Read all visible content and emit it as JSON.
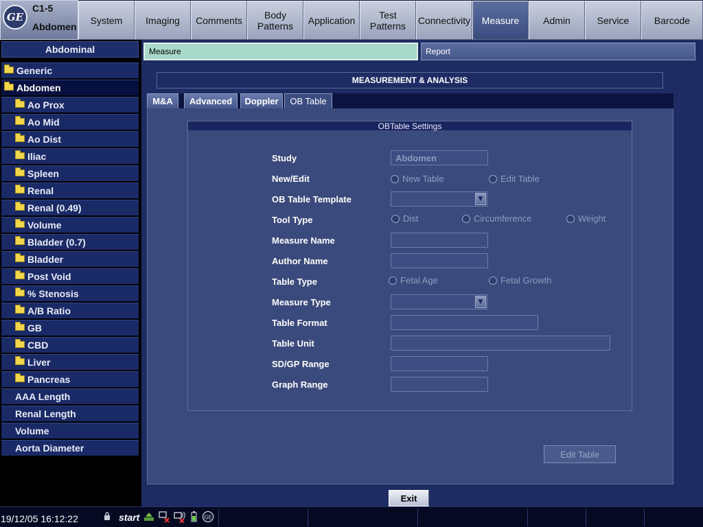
{
  "header": {
    "logo_text": "GE",
    "probe": "C1-5",
    "preset": "Abdomen",
    "tabs": [
      {
        "label": "System",
        "active": false
      },
      {
        "label": "Imaging",
        "active": false
      },
      {
        "label": "Comments",
        "active": false
      },
      {
        "label": "Body\nPatterns",
        "active": false
      },
      {
        "label": "Application",
        "active": false
      },
      {
        "label": "Test\nPatterns",
        "active": false
      },
      {
        "label": "Connectivity",
        "active": false
      },
      {
        "label": "Measure",
        "active": true
      },
      {
        "label": "Admin",
        "active": false
      },
      {
        "label": "Service",
        "active": false
      },
      {
        "label": "Barcode",
        "active": false
      }
    ]
  },
  "sidebar": {
    "header": "Abdominal",
    "items": [
      {
        "label": "Generic",
        "folder": true,
        "level": 0,
        "active": false
      },
      {
        "label": "Abdomen",
        "folder": true,
        "level": 0,
        "active": true
      },
      {
        "label": "Ao Prox",
        "folder": true,
        "level": 1,
        "active": false
      },
      {
        "label": "Ao Mid",
        "folder": true,
        "level": 1,
        "active": false
      },
      {
        "label": "Ao Dist",
        "folder": true,
        "level": 1,
        "active": false
      },
      {
        "label": "Iliac",
        "folder": true,
        "level": 1,
        "active": false
      },
      {
        "label": "Spleen",
        "folder": true,
        "level": 1,
        "active": false
      },
      {
        "label": "Renal",
        "folder": true,
        "level": 1,
        "active": false
      },
      {
        "label": "Renal (0.49)",
        "folder": true,
        "level": 1,
        "active": false
      },
      {
        "label": "Volume",
        "folder": true,
        "level": 1,
        "active": false
      },
      {
        "label": "Bladder (0.7)",
        "folder": true,
        "level": 1,
        "active": false
      },
      {
        "label": "Bladder",
        "folder": true,
        "level": 1,
        "active": false
      },
      {
        "label": "Post Void",
        "folder": true,
        "level": 1,
        "active": false
      },
      {
        "label": "% Stenosis",
        "folder": true,
        "level": 1,
        "active": false
      },
      {
        "label": "A/B Ratio",
        "folder": true,
        "level": 1,
        "active": false
      },
      {
        "label": "GB",
        "folder": true,
        "level": 1,
        "active": false
      },
      {
        "label": "CBD",
        "folder": true,
        "level": 1,
        "active": false
      },
      {
        "label": "Liver",
        "folder": true,
        "level": 1,
        "active": false
      },
      {
        "label": "Pancreas",
        "folder": true,
        "level": 1,
        "active": false
      },
      {
        "label": "AAA Length",
        "folder": false,
        "level": 1,
        "active": false
      },
      {
        "label": "Renal Length",
        "folder": false,
        "level": 1,
        "active": false
      },
      {
        "label": "Volume",
        "folder": false,
        "level": 1,
        "active": false
      },
      {
        "label": "Aorta Diameter",
        "folder": false,
        "level": 1,
        "active": false
      }
    ]
  },
  "main": {
    "measure_tab": "Measure",
    "report_tab": "Report",
    "section_title": "MEASUREMENT & ANALYSIS",
    "subtabs": [
      {
        "label": "M&A",
        "active": false
      },
      {
        "label": "Advanced",
        "active": false
      },
      {
        "label": "Doppler",
        "active": false
      },
      {
        "label": "OB Table",
        "active": true
      }
    ],
    "settings": {
      "title": "OBTable Settings",
      "rows": {
        "study": "Study",
        "new_edit": "New/Edit",
        "template": "OB Table Template",
        "tool_type": "Tool Type",
        "measure_name": "Measure Name",
        "author_name": "Author Name",
        "table_type": "Table Type",
        "measure_type": "Measure Type",
        "table_format": "Table Format",
        "table_unit": "Table Unit",
        "sd_gp_range": "SD/GP Range",
        "graph_range": "Graph Range"
      },
      "study_value": "Abdomen",
      "new_table": "New Table",
      "edit_table_radio": "Edit Table",
      "tool_dist": "Dist",
      "tool_circumference": "Circumference",
      "tool_weight": "Weight",
      "fetal_age": "Fetal Age",
      "fetal_growth": "Fetal Growth"
    },
    "edit_table_button": "Edit Table",
    "exit_button": "Exit"
  },
  "status": {
    "datetime": "19/12/05 16:12:22",
    "start": "start"
  }
}
